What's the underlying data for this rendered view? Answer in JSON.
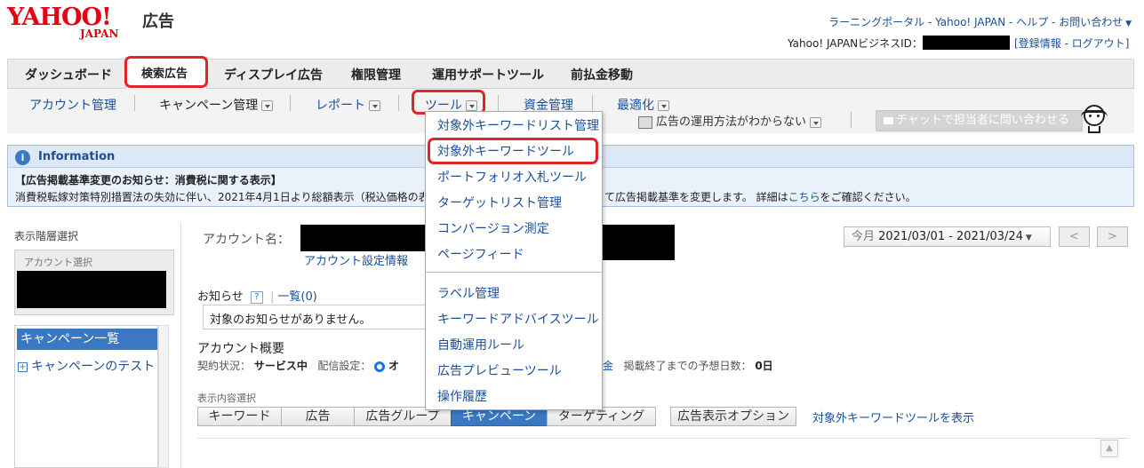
{
  "logo": {
    "word": "YAHOO!",
    "sub": "JAPAN",
    "ad": "広告"
  },
  "header": {
    "links": [
      "ラーニングポータル",
      "Yahoo! JAPAN",
      "ヘルプ",
      "お問い合わせ"
    ],
    "sep": " - ",
    "business_id_label": "Yahoo! JAPANビジネスID：",
    "account_links": [
      "登録情報",
      "ログアウト"
    ],
    "bracket_open": "[",
    "bracket_close": "]"
  },
  "tabs": [
    "ダッシュボード",
    "検索広告",
    "ディスプレイ広告",
    "権限管理",
    "運用サポートツール",
    "前払金移動"
  ],
  "subnav": {
    "account": "アカウント管理",
    "campaign": "キャンペーン管理",
    "report": "レポート",
    "tool": "ツール",
    "funds": "資金管理",
    "optimize": "最適化",
    "howto": "広告の運用方法がわからない",
    "chat": "チャットで担当者に問い合わせる"
  },
  "dropdown": {
    "group1": [
      "対象外キーワードリスト管理",
      "対象外キーワードツール",
      "ポートフォリオ入札ツール",
      "ターゲットリスト管理",
      "コンバージョン測定",
      "ページフィード"
    ],
    "group2": [
      "ラベル管理",
      "キーワードアドバイスツール",
      "自動運用ルール",
      "広告プレビューツール",
      "操作履歴"
    ]
  },
  "info": {
    "title": "Information",
    "heading": "【広告掲載基準変更のお知らせ：消費税に関する表示】",
    "body_a": "消費税転嫁対策特別措置法の失効に伴い、2021年4月1日より総額表示（税込価格の表",
    "body_b": "て広告掲載基準を変更します。 詳細は",
    "link": "こちら",
    "body_c": "をご確認ください。"
  },
  "sidebar": {
    "title": "表示階層選択",
    "account_select": "アカウント選択",
    "campaign_list": "キャンペーン一覧",
    "campaign_item": "キャンペーンのテスト"
  },
  "main": {
    "account_name_label": "アカウント名：",
    "account_settings": "アカウント設定情報",
    "date_prefix": "今月",
    "date_range": "2021/03/01 - 2021/03/24",
    "notice_label": "お知らせ",
    "help": "?",
    "list_link": "一覧(0)",
    "no_notice": "対象のお知らせがありません。",
    "overview": "アカウント概要",
    "contract_label": "契約状況：",
    "contract_value": "サービス中",
    "delivery_label": "配信設定：",
    "delivery_value": "オ",
    "funds_word": "金",
    "days_label": "掲載終了までの予想日数：",
    "days_value": "0日",
    "display_select": "表示内容選択",
    "segments": [
      "キーワード",
      "広告",
      "広告グループ",
      "キャンペーン",
      "ターゲティング"
    ],
    "ad_option": "広告表示オプション",
    "show_tool": "対象外キーワードツールを表示"
  }
}
